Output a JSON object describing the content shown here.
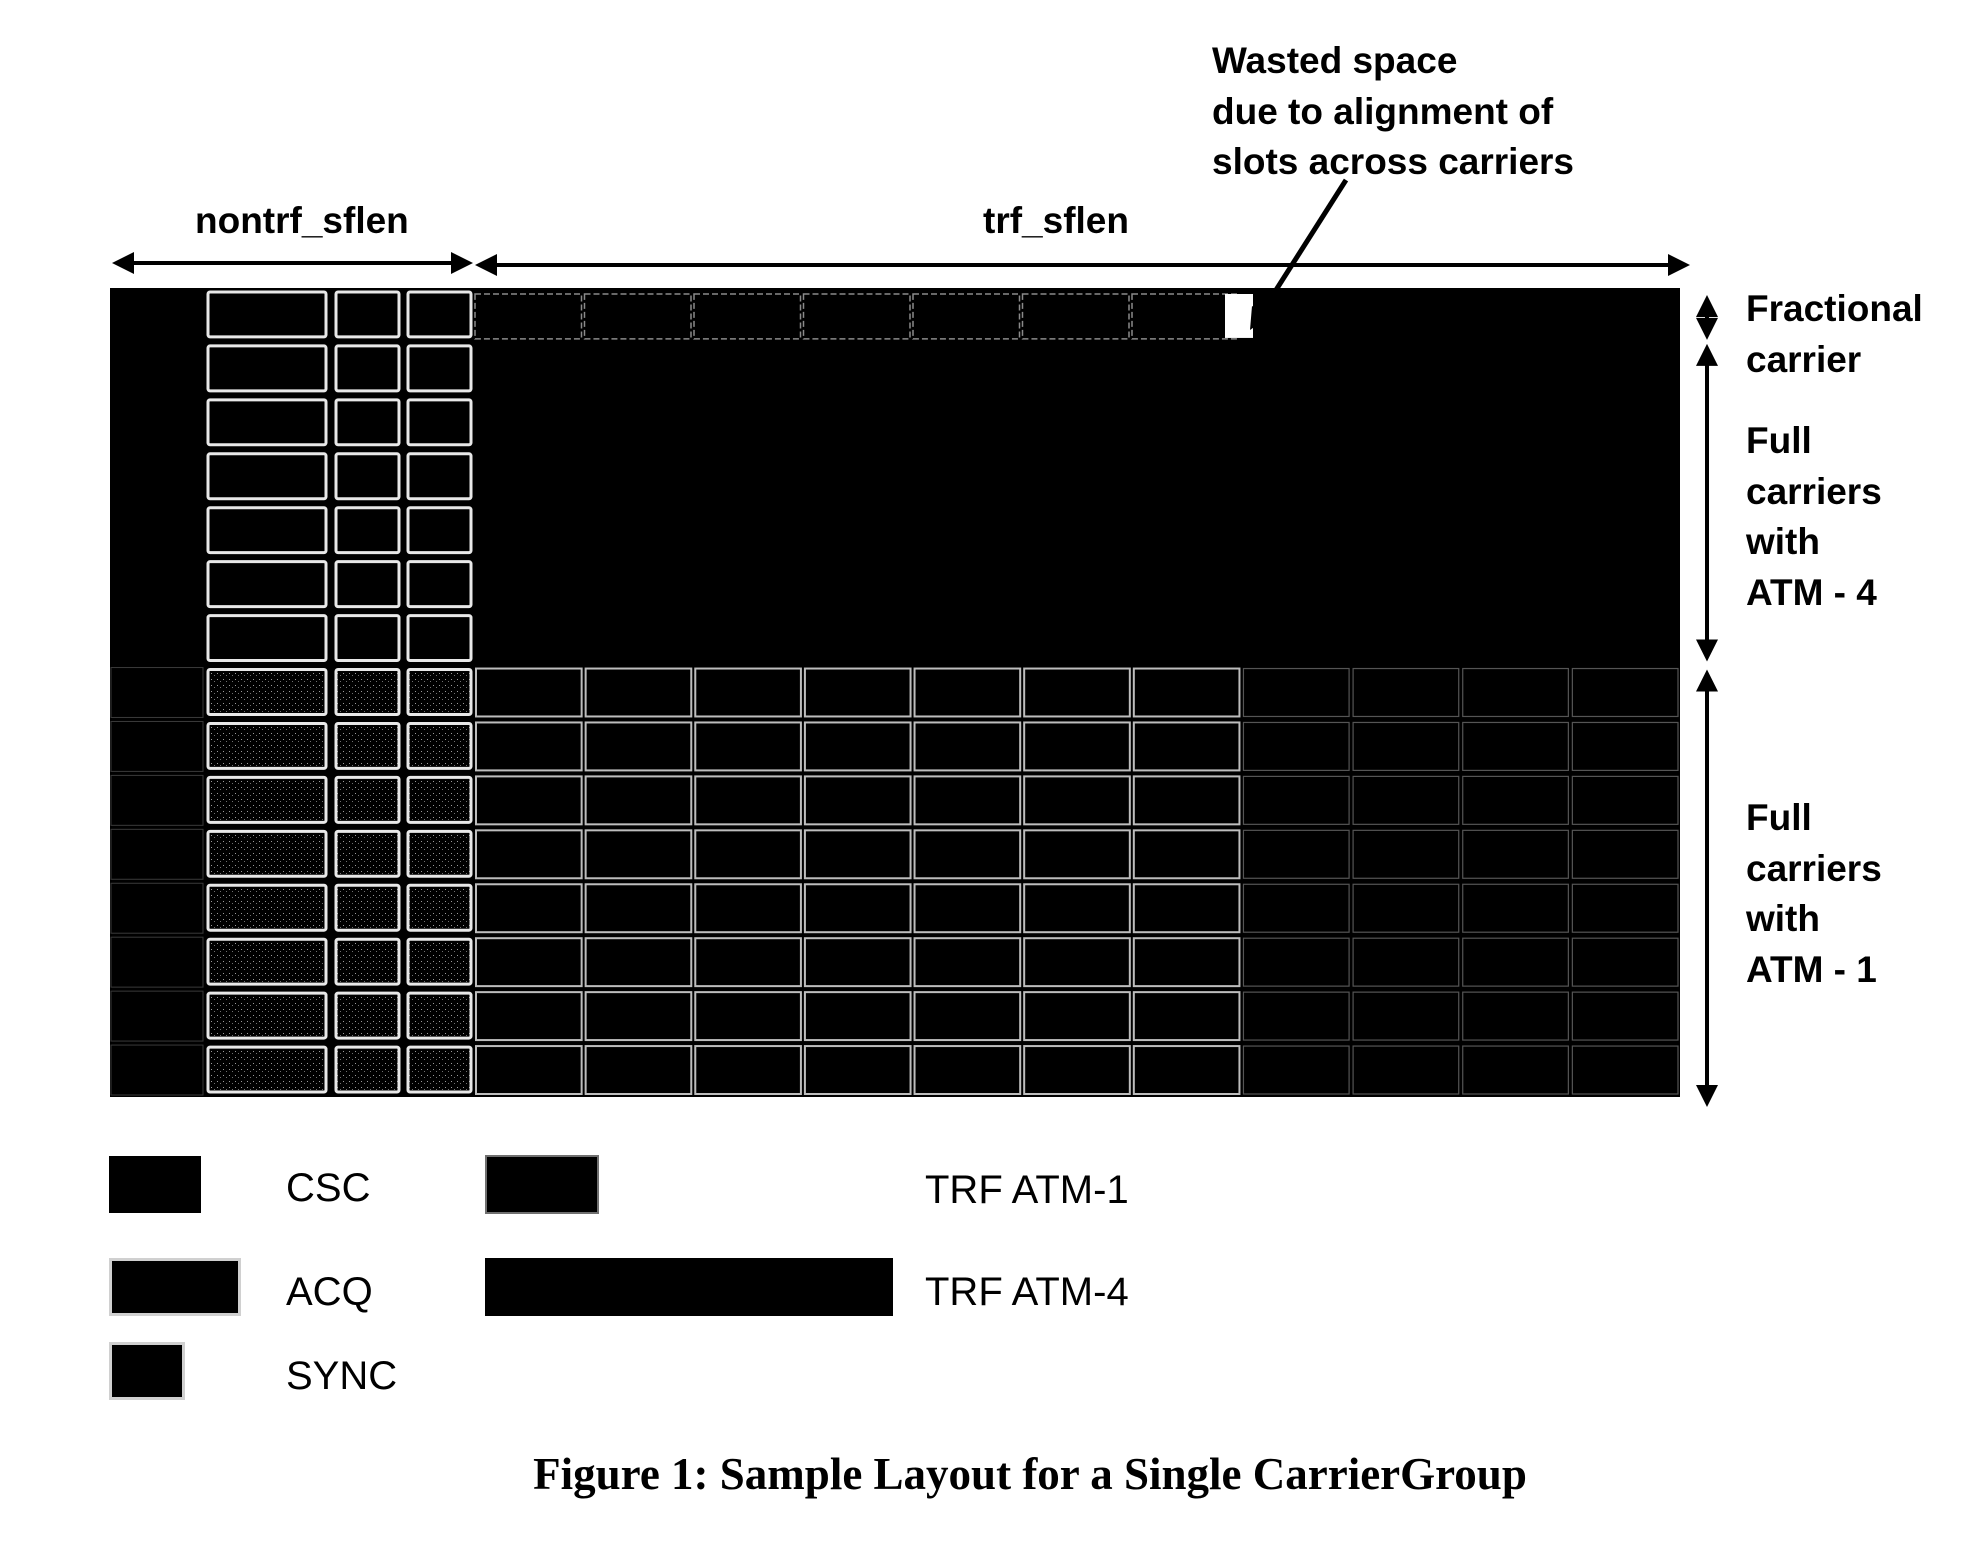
{
  "figure": {
    "caption": "Figure 1: Sample Layout for a Single CarrierGroup",
    "dimension_labels": {
      "nontrf": "nontrf_sflen",
      "trf": "trf_sflen"
    },
    "annotation": "Wasted space\ndue to alignment of\nslots across carriers",
    "side_labels": {
      "fractional": "Fractional\ncarrier",
      "atm4": "Full\ncarriers\nwith\nATM - 4",
      "atm1": "Full\ncarriers\nwith\nATM - 1"
    },
    "layout": {
      "carrier_rows": {
        "fractional": 1,
        "full_atm4": 6,
        "full_atm1": 8
      },
      "nontraffic_slots_per_row": [
        "CSC",
        "ACQ",
        "SYNC",
        "SYNC"
      ],
      "fractional_trf_atm1_slots": 7,
      "fractional_wasted_slots": 1,
      "full_atm1_trf_slots_per_row": 11,
      "full_atm4_trf_slots_per_row": 1
    },
    "legend": [
      {
        "key": "csc",
        "label": "CSC"
      },
      {
        "key": "acq",
        "label": "ACQ"
      },
      {
        "key": "sync",
        "label": "SYNC"
      },
      {
        "key": "trf1",
        "label": "TRF ATM-1"
      },
      {
        "key": "trf4",
        "label": "TRF ATM-4"
      }
    ],
    "colors": {
      "slot_fill": "#000000",
      "slot_outline": "#e8e8e8",
      "wasted": "#ffffff"
    }
  }
}
